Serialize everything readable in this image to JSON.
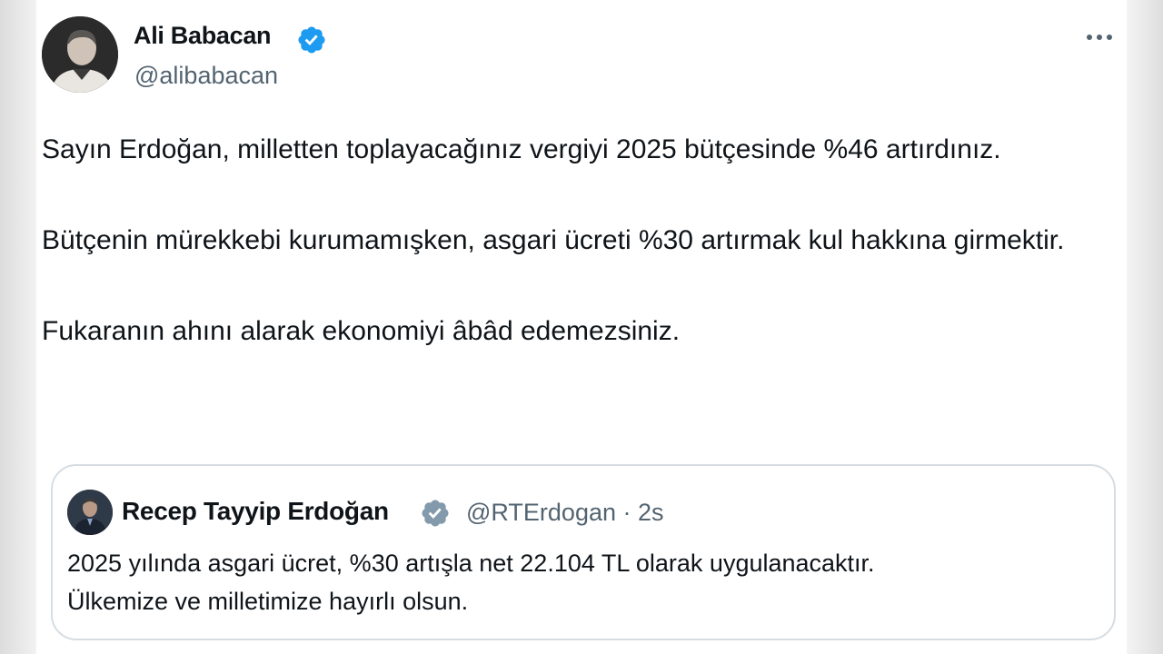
{
  "tweet": {
    "author_name": "Ali Babacan",
    "handle": "@alibabacan",
    "verified_icon": "verified-badge-icon",
    "more_icon": "more-options-icon",
    "paragraphs": [
      "Sayın Erdoğan, milletten toplayacağınız vergiyi 2025 bütçesinde %46 artırdınız.",
      "Bütçenin mürekkebi kurumamışken, asgari ücreti %30 artırmak kul hakkına girmektir.",
      "Fukaranın ahını alarak ekonomiyi âbâd edemezsiniz."
    ]
  },
  "quoted_tweet": {
    "author_name": "Recep Tayyip Erdoğan",
    "handle": "@RTErdogan",
    "separator": "·",
    "time": "2s",
    "lines": [
      "2025 yılında asgari ücret, %30 artışla net 22.104 TL olarak uygulanacaktır.",
      "Ülkemize ve milletimize hayırlı olsun."
    ]
  },
  "colors": {
    "verified_blue": "#1d9bf0",
    "verified_gray": "#829aab",
    "secondary_text": "#536471",
    "border": "#d6dde2"
  }
}
